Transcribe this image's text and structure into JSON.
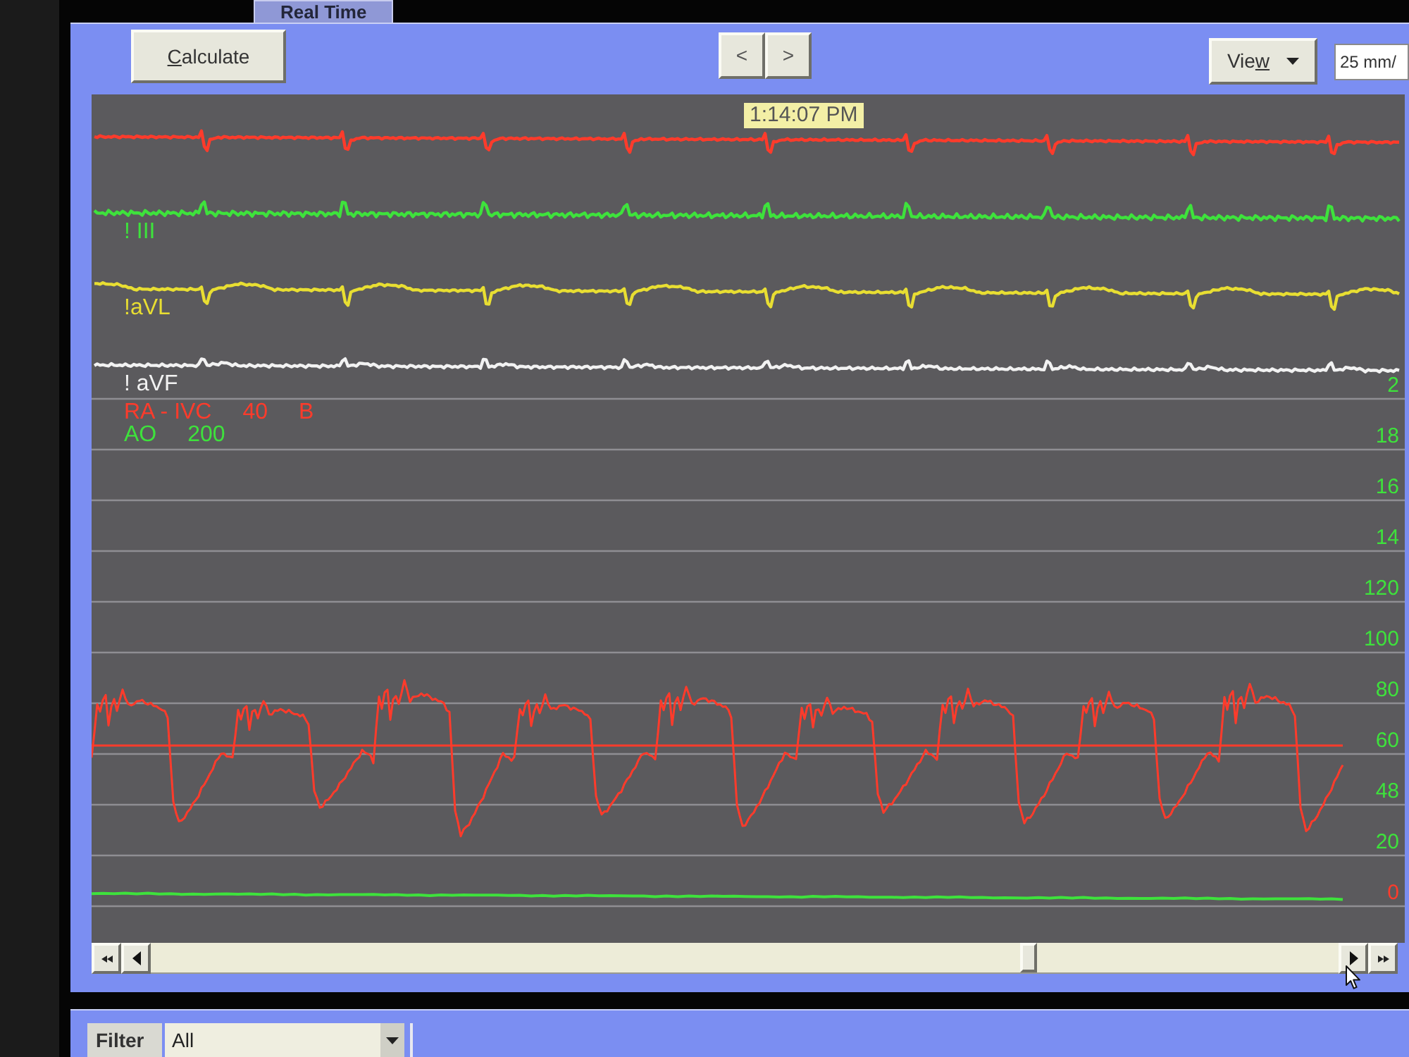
{
  "tabs": [
    {
      "label": "Real Time",
      "selected": true
    }
  ],
  "toolbar": {
    "calculate_button": {
      "label": [
        {
          "text": "C",
          "underlined": true
        },
        {
          "text": "alculate",
          "underlined": false
        }
      ]
    },
    "nav_buttons": [
      "<",
      ">"
    ],
    "view_button": {
      "label": [
        {
          "text": "Vie",
          "underlined": false
        },
        {
          "text": "w",
          "underlined": true
        }
      ]
    },
    "sweep_speed_field": {
      "value": "25 mm/"
    }
  },
  "waveform_panel": {
    "time_marker": "1:14:07 PM",
    "ecg_leads": [
      {
        "color": "#ff3b2b"
      },
      {
        "label": "! III",
        "color": "#3ee23c"
      },
      {
        "label": "!aVL",
        "color": "#e8de32"
      },
      {
        "label": "! aVF",
        "color": "#f2f2f2"
      }
    ],
    "pressure_channels": [
      {
        "kind": "pulsatile",
        "parts": [
          "RA - IVC",
          "40",
          "B"
        ],
        "color": "#ff3b2b"
      },
      {
        "kind": "flat",
        "parts": [
          "AO",
          "200"
        ],
        "color": "#3ee23c"
      }
    ],
    "scale_labels": [
      {
        "text": "2",
        "color": "#3ee23c"
      },
      {
        "text": "18",
        "color": "#3ee23c"
      },
      {
        "text": "16",
        "color": "#3ee23c"
      },
      {
        "text": "14",
        "color": "#3ee23c"
      },
      {
        "text": "120",
        "color": "#3ee23c"
      },
      {
        "text": "100",
        "color": "#3ee23c"
      },
      {
        "text": "80",
        "color": "#3ee23c"
      },
      {
        "text": "60",
        "color": "#3ee23c"
      },
      {
        "text": "48",
        "color": "#3ee23c"
      },
      {
        "text": "20",
        "color": "#3ee23c"
      },
      {
        "text": "0",
        "color": "#ff3b2b"
      }
    ]
  },
  "filter": {
    "label": "Filter",
    "value": "All"
  }
}
